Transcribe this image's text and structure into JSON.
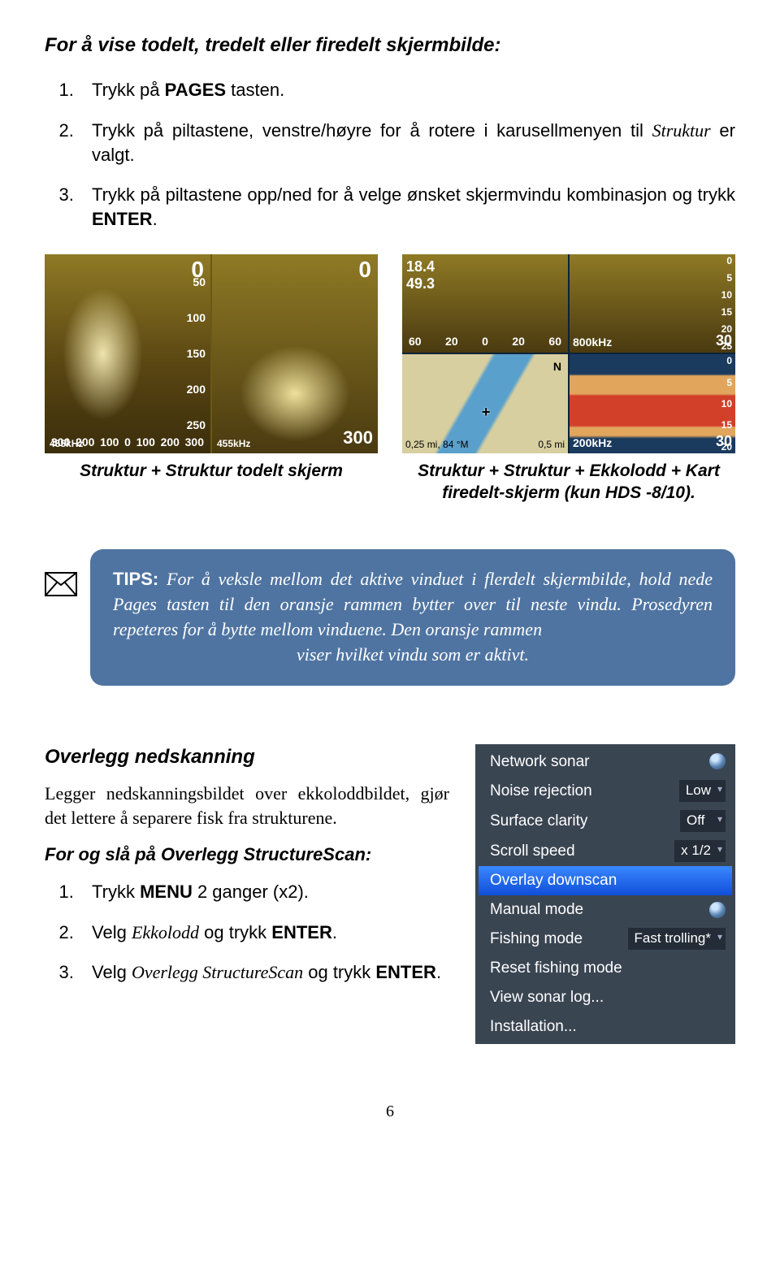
{
  "heading": "For å vise todelt, tredelt eller firedelt skjermbilde:",
  "steps1": {
    "a_pre": "Trykk på ",
    "a_pages": "PAGES",
    "a_post": " tasten.",
    "b_pre": "Trykk på piltastene, venstre/høyre for å rotere i karusellmenyen til ",
    "b_em": "Struktur",
    "b_post": " er valgt.",
    "c_pre": "Trykk  på  piltastene  opp/ned  for  å  velge  ønsket  skjermvindu kombinasjon og trykk ",
    "c_enter": "ENTER",
    "c_post": "."
  },
  "screens": {
    "left": {
      "caption": "Struktur + Struktur todelt skjerm",
      "panes": {
        "p1": {
          "top": "0",
          "ruler": [
            "50",
            "100",
            "150",
            "200",
            "250"
          ],
          "bl": "455kHz",
          "scale": [
            "300",
            "200",
            "100",
            "0",
            "100",
            "200",
            "300"
          ]
        },
        "p2": {
          "top": "0",
          "bl": "455kHz",
          "br": "300"
        }
      }
    },
    "right": {
      "caption_l1": "Struktur + Struktur + Ekkolodd + Kart",
      "caption_l2": "firedelt-skjerm (kun HDS -8/10).",
      "q1": {
        "hdr1": "18.4",
        "hdr2": "49.3",
        "scale": [
          "60",
          "20",
          "0",
          "20",
          "60"
        ]
      },
      "q2": {
        "ruler": [
          "0",
          "5",
          "10",
          "15",
          "20",
          "25"
        ],
        "bl": "800kHz",
        "br": "30"
      },
      "map": {
        "compass": "N",
        "plus": "+",
        "bl": "0,25 mi, 84 °M",
        "br": "0,5 mi"
      },
      "ech": {
        "ruler": [
          "0",
          "5",
          "10",
          "15",
          "20"
        ],
        "bl": "200kHz",
        "br": "30"
      }
    }
  },
  "tips": {
    "label": "TIPS:",
    "body": " For å veksle mellom det aktive vinduet i flerdelt skjermbilde, hold nede Pages tasten til den oransje rammen bytter over til neste vindu. Prosedyren repeteres for å bytte mellom vinduene. Den oransje rammen",
    "last": "viser hvilket vindu som er aktivt."
  },
  "overlegg": {
    "title": "Overlegg nedskanning",
    "body": "Legger nedskanningsbildet over ekkoloddbildet, gjør det lettere å separere fisk fra strukturene.",
    "sub": "For og slå på Overlegg StructureScan:",
    "s1_pre": "Trykk ",
    "s1_menu": "MENU",
    "s1_post": " 2 ganger (x2).",
    "s2_pre": "Velg ",
    "s2_em": "Ekkolodd",
    "s2_mid": " og trykk ",
    "s2_enter": "ENTER",
    "s2_post": ".",
    "s3_pre": "Velg  ",
    "s3_em": "Overlegg  StructureScan",
    "s3_mid": "  og  trykk ",
    "s3_enter": "ENTER",
    "s3_post": "."
  },
  "menu": {
    "items": [
      {
        "label": "Network sonar",
        "type": "radio"
      },
      {
        "label": "Noise rejection",
        "type": "val",
        "val": "Low"
      },
      {
        "label": "Surface clarity",
        "type": "val",
        "val": "Off"
      },
      {
        "label": "Scroll speed",
        "type": "val",
        "val": "x 1/2"
      },
      {
        "label": "Overlay downscan",
        "type": "sel"
      },
      {
        "label": "Manual mode",
        "type": "radio"
      },
      {
        "label": "Fishing mode",
        "type": "val",
        "val": "Fast trolling*"
      },
      {
        "label": "Reset fishing mode",
        "type": "none"
      },
      {
        "label": "View sonar log...",
        "type": "none"
      },
      {
        "label": "Installation...",
        "type": "none"
      }
    ]
  },
  "pagenum": "6"
}
